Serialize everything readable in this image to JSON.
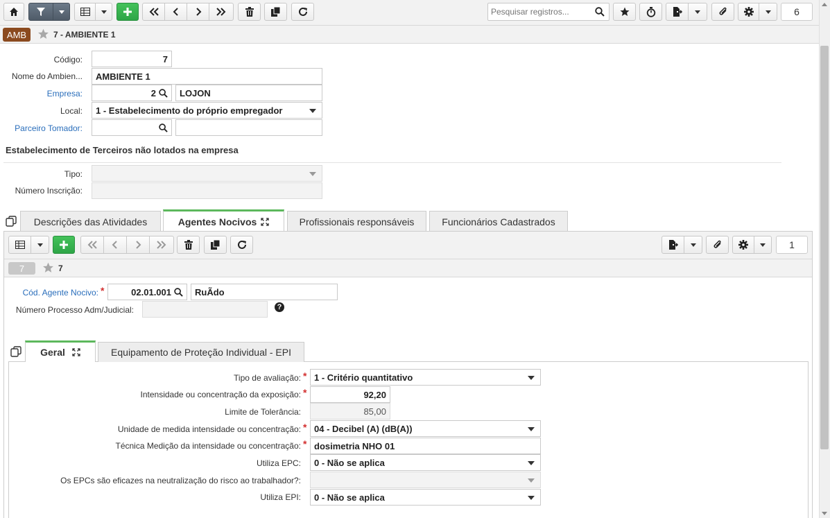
{
  "toolbar": {
    "search_placeholder": "Pesquisar registros...",
    "record_count": "6"
  },
  "record": {
    "badge": "AMB",
    "title": "7 - AMBIENTE 1"
  },
  "form": {
    "codigo_label": "Código:",
    "codigo_value": "7",
    "nome_label": "Nome do Ambien...",
    "nome_value": "AMBIENTE 1",
    "empresa_label": "Empresa:",
    "empresa_code": "2",
    "empresa_name": "LOJON",
    "local_label": "Local:",
    "local_value": "1 - Estabelecimento do próprio empregador",
    "parceiro_label": "Parceiro Tomador:",
    "section_title": "Estabelecimento de Terceiros não lotados na empresa",
    "tipo_label": "Tipo:",
    "numero_inscricao_label": "Número Inscrição:"
  },
  "tabs": [
    {
      "label": "Descrições das Atividades"
    },
    {
      "label": "Agentes Nocivos"
    },
    {
      "label": "Profissionais responsáveis"
    },
    {
      "label": "Funcionários Cadastrados"
    }
  ],
  "sub": {
    "record_count": "1",
    "badge": "7",
    "title": "7",
    "agente_label": "Cód. Agente Nocivo:",
    "agente_code": "02.01.001",
    "agente_name": "RuÃdo",
    "processo_label": "Número Processo Adm/Judicial:"
  },
  "inner_tabs": [
    {
      "label": "Geral"
    },
    {
      "label": "Equipamento de Proteção Individual - EPI"
    }
  ],
  "geral": {
    "tipo_avaliacao_label": "Tipo de avaliação:",
    "tipo_avaliacao_value": "1 - Critério quantitativo",
    "intensidade_label": "Intensidade ou concentração da exposição:",
    "intensidade_value": "92,20",
    "limite_label": "Limite de Tolerância:",
    "limite_value": "85,00",
    "unidade_label": "Unidade de medida intensidade ou concentração:",
    "unidade_value": "04 - Decibel (A) (dB(A))",
    "tecnica_label": "Técnica Medição da intensidade ou concentração:",
    "tecnica_value": "dosimetria NHO 01",
    "epc_label": "Utiliza EPC:",
    "epc_value": "0 - Não se aplica",
    "epc_eficaz_label": "Os EPCs são eficazes na neutralização do risco ao trabalhador?:",
    "epi_label": "Utiliza EPI:",
    "epi_value": "0 - Não se aplica"
  },
  "colors": {
    "badge_brown": "#8b4a1f",
    "green": "#33aa4a",
    "link": "#2a6ebb"
  }
}
